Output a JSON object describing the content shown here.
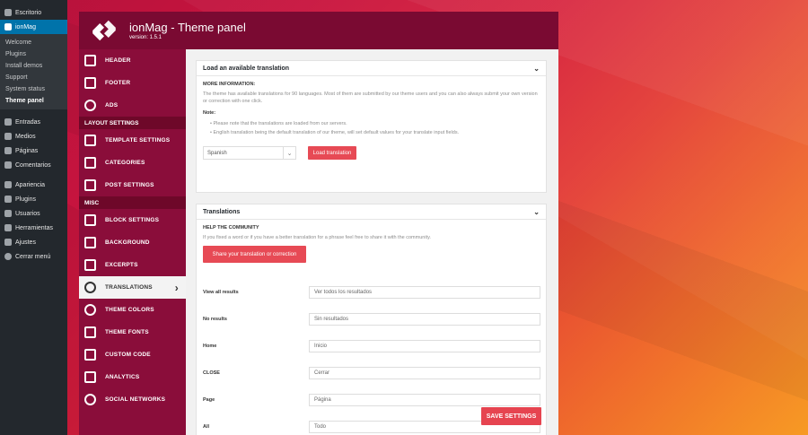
{
  "wp_menu": {
    "escritorio": "Escritorio",
    "ionmag": "ionMag",
    "sub": [
      "Welcome",
      "Plugins",
      "Install demos",
      "Support",
      "System status",
      "Theme panel"
    ],
    "main": [
      "Entradas",
      "Medios",
      "Páginas",
      "Comentarios"
    ],
    "main2": [
      "Apariencia",
      "Plugins",
      "Usuarios",
      "Herramientas",
      "Ajustes",
      "Cerrar menú"
    ]
  },
  "header": {
    "title": "ionMag - Theme panel",
    "version": "version: 1.5.1"
  },
  "theme_nav": {
    "top_items": [
      "HEADER",
      "FOOTER",
      "ADS"
    ],
    "section_layout": "LAYOUT SETTINGS",
    "layout_items": [
      "TEMPLATE SETTINGS",
      "CATEGORIES",
      "POST SETTINGS"
    ],
    "section_misc": "MISC",
    "misc_items": [
      "BLOCK SETTINGS",
      "BACKGROUND",
      "EXCERPTS",
      "TRANSLATIONS",
      "THEME COLORS",
      "THEME FONTS",
      "CUSTOM CODE",
      "ANALYTICS",
      "SOCIAL NETWORKS"
    ]
  },
  "load_box": {
    "title": "Load an available translation",
    "more_info_label": "MORE INFORMATION:",
    "more_info_text": "The theme has available translations for 90 languages. Most of them are submitted by our theme users and you can also always submit your own version or correction with one click.",
    "note_label": "Note:",
    "notes": [
      "Please note that the translations are loaded from our servers.",
      "English translation being the default translation of our theme, will set default values for your translate input fields."
    ],
    "language_selected": "Spanish",
    "load_button": "Load translation"
  },
  "translations_box": {
    "title": "Translations",
    "help_label": "HELP THE COMMUNITY",
    "help_text": "If you fixed a word or if you have a better translation for a phrase feel free to share it with the community.",
    "share_button": "Share your translation or correction",
    "rows": [
      {
        "key": "View all results",
        "value": "Ver todos los resultados"
      },
      {
        "key": "No results",
        "value": "Sin resultados"
      },
      {
        "key": "Home",
        "value": "Inicio"
      },
      {
        "key": "CLOSE",
        "value": "Cerrar"
      },
      {
        "key": "Page",
        "value": "Página"
      },
      {
        "key": "All",
        "value": "Todo"
      }
    ]
  },
  "save_button": "SAVE SETTINGS",
  "colors": {
    "accent": "#e74a55",
    "nav_bg": "#8a0d3a",
    "wp_active": "#0073aa"
  }
}
